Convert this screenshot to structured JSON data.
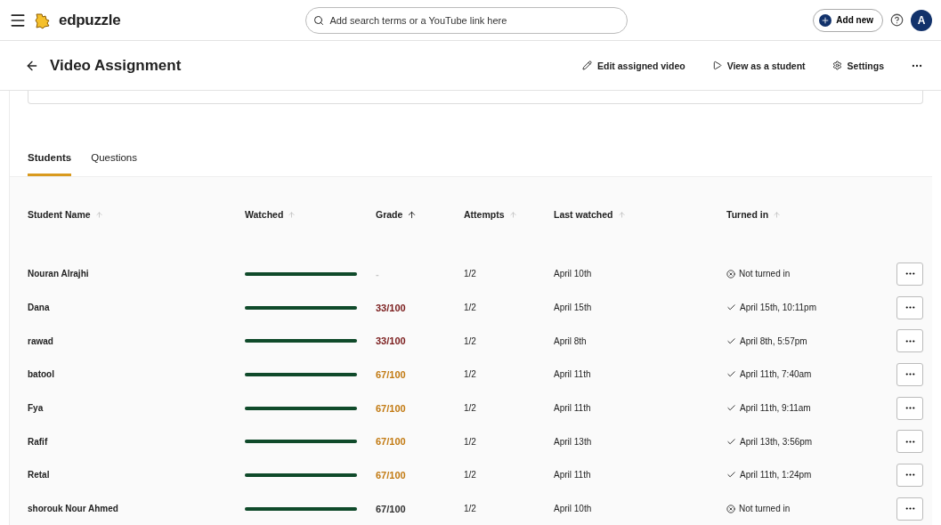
{
  "top_bar": {
    "logo": "edpuzzle",
    "search": {
      "placeholder": "Add search terms or a YouTube link here"
    },
    "add_button": "Add new",
    "avatar": "A"
  },
  "header": {
    "title": "Video Assignment",
    "actions": [
      {
        "kind": "edit",
        "label": "Edit assigned video"
      },
      {
        "kind": "view",
        "label": "View as a student"
      },
      {
        "kind": "settings",
        "label": "Settings"
      }
    ]
  },
  "tabs": [
    {
      "label": "Students",
      "selected": true
    },
    {
      "label": "Questions",
      "selected": false
    }
  ],
  "table": {
    "columns": [
      {
        "label": "Student Name",
        "sorted": false
      },
      {
        "label": "Watched",
        "sorted": false
      },
      {
        "label": "Grade",
        "sorted": true
      },
      {
        "label": "Attempts",
        "sorted": false
      },
      {
        "label": "Last watched",
        "sorted": false
      },
      {
        "label": "Turned in",
        "sorted": false
      }
    ],
    "rows": [
      {
        "name": "Nouran Alrajhi",
        "watched": {
          "level": 1
        },
        "grade": "-",
        "attempts": "1/2",
        "last_watched": "April 10th",
        "turned_in": {
          "kind": "missing",
          "text": "Not turned in"
        }
      },
      {
        "name": "Dana",
        "watched": {
          "level": 1
        },
        "grade": "33/100",
        "color": "#7a1c1c",
        "attempts": "1/2",
        "last_watched": "April 15th",
        "turned_in": {
          "kind": "done",
          "text": "April 15th, 10:11pm"
        }
      },
      {
        "name": "rawad",
        "watched": {
          "level": 1
        },
        "grade": "33/100",
        "color": "#7a1c1c",
        "attempts": "1/2",
        "last_watched": "April 8th",
        "turned_in": {
          "kind": "done",
          "text": "April 8th, 5:57pm"
        }
      },
      {
        "name": "batool",
        "watched": {
          "level": 1
        },
        "grade": "67/100",
        "color": "#c27a12",
        "attempts": "1/2",
        "last_watched": "April 11th",
        "turned_in": {
          "kind": "done",
          "text": "April 11th, 7:40am"
        }
      },
      {
        "name": "Fya",
        "watched": {
          "level": 1
        },
        "grade": "67/100",
        "color": "#c27a12",
        "attempts": "1/2",
        "last_watched": "April 11th",
        "turned_in": {
          "kind": "done",
          "text": "April 11th, 9:11am"
        }
      },
      {
        "name": "Rafif",
        "watched": {
          "level": 1
        },
        "grade": "67/100",
        "color": "#c27a12",
        "attempts": "1/2",
        "last_watched": "April 13th",
        "turned_in": {
          "kind": "done",
          "text": "April 13th, 3:56pm"
        }
      },
      {
        "name": "Retal",
        "watched": {
          "level": 1
        },
        "grade": "67/100",
        "color": "#c27a12",
        "attempts": "1/2",
        "last_watched": "April 11th",
        "turned_in": {
          "kind": "done",
          "text": "April 11th, 1:24pm"
        }
      },
      {
        "name": "shorouk Nour Ahmed",
        "watched": {
          "level": 1
        },
        "grade": "67/100",
        "color": "#333333",
        "attempts": "1/2",
        "last_watched": "April 10th",
        "turned_in": {
          "kind": "missing",
          "text": "Not turned in"
        }
      }
    ]
  }
}
